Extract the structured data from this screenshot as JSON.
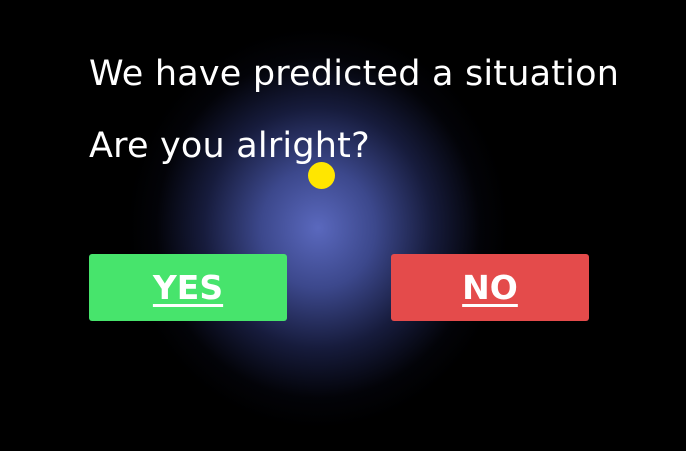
{
  "dialog": {
    "message_line1": "We have predicted a situation",
    "message_line2": "Are you alright?"
  },
  "buttons": {
    "yes": {
      "label": "YES",
      "color": "#47e46c"
    },
    "no": {
      "label": "NO",
      "color": "#e44b4b"
    }
  },
  "pointer": {
    "color": "#ffe600"
  },
  "colors": {
    "background": "#000000",
    "glow": "#5f6ec8",
    "text": "#ffffff"
  }
}
